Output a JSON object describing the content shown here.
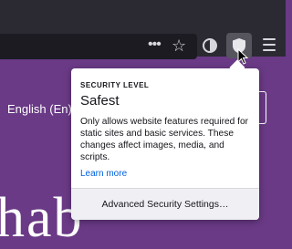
{
  "toolbar": {
    "more_label": "•••",
    "bookmark_label": "☆"
  },
  "page": {
    "language_label": "English (En)",
    "large_text": "hab"
  },
  "popup": {
    "heading": "SECURITY LEVEL",
    "level": "Safest",
    "description": "Only allows website features required for static sites and basic services. These changes affect images, media, and scripts.",
    "learn_more": "Learn more",
    "advanced_button": "Advanced Security Settings…"
  },
  "colors": {
    "accent": "#0061e0",
    "page_bg": "#6a3a86",
    "toolbar_bg": "#2b2a33"
  },
  "icons": [
    "star-icon",
    "onion-icon",
    "shield-icon",
    "hamburger-menu-icon",
    "cursor-pointer"
  ]
}
